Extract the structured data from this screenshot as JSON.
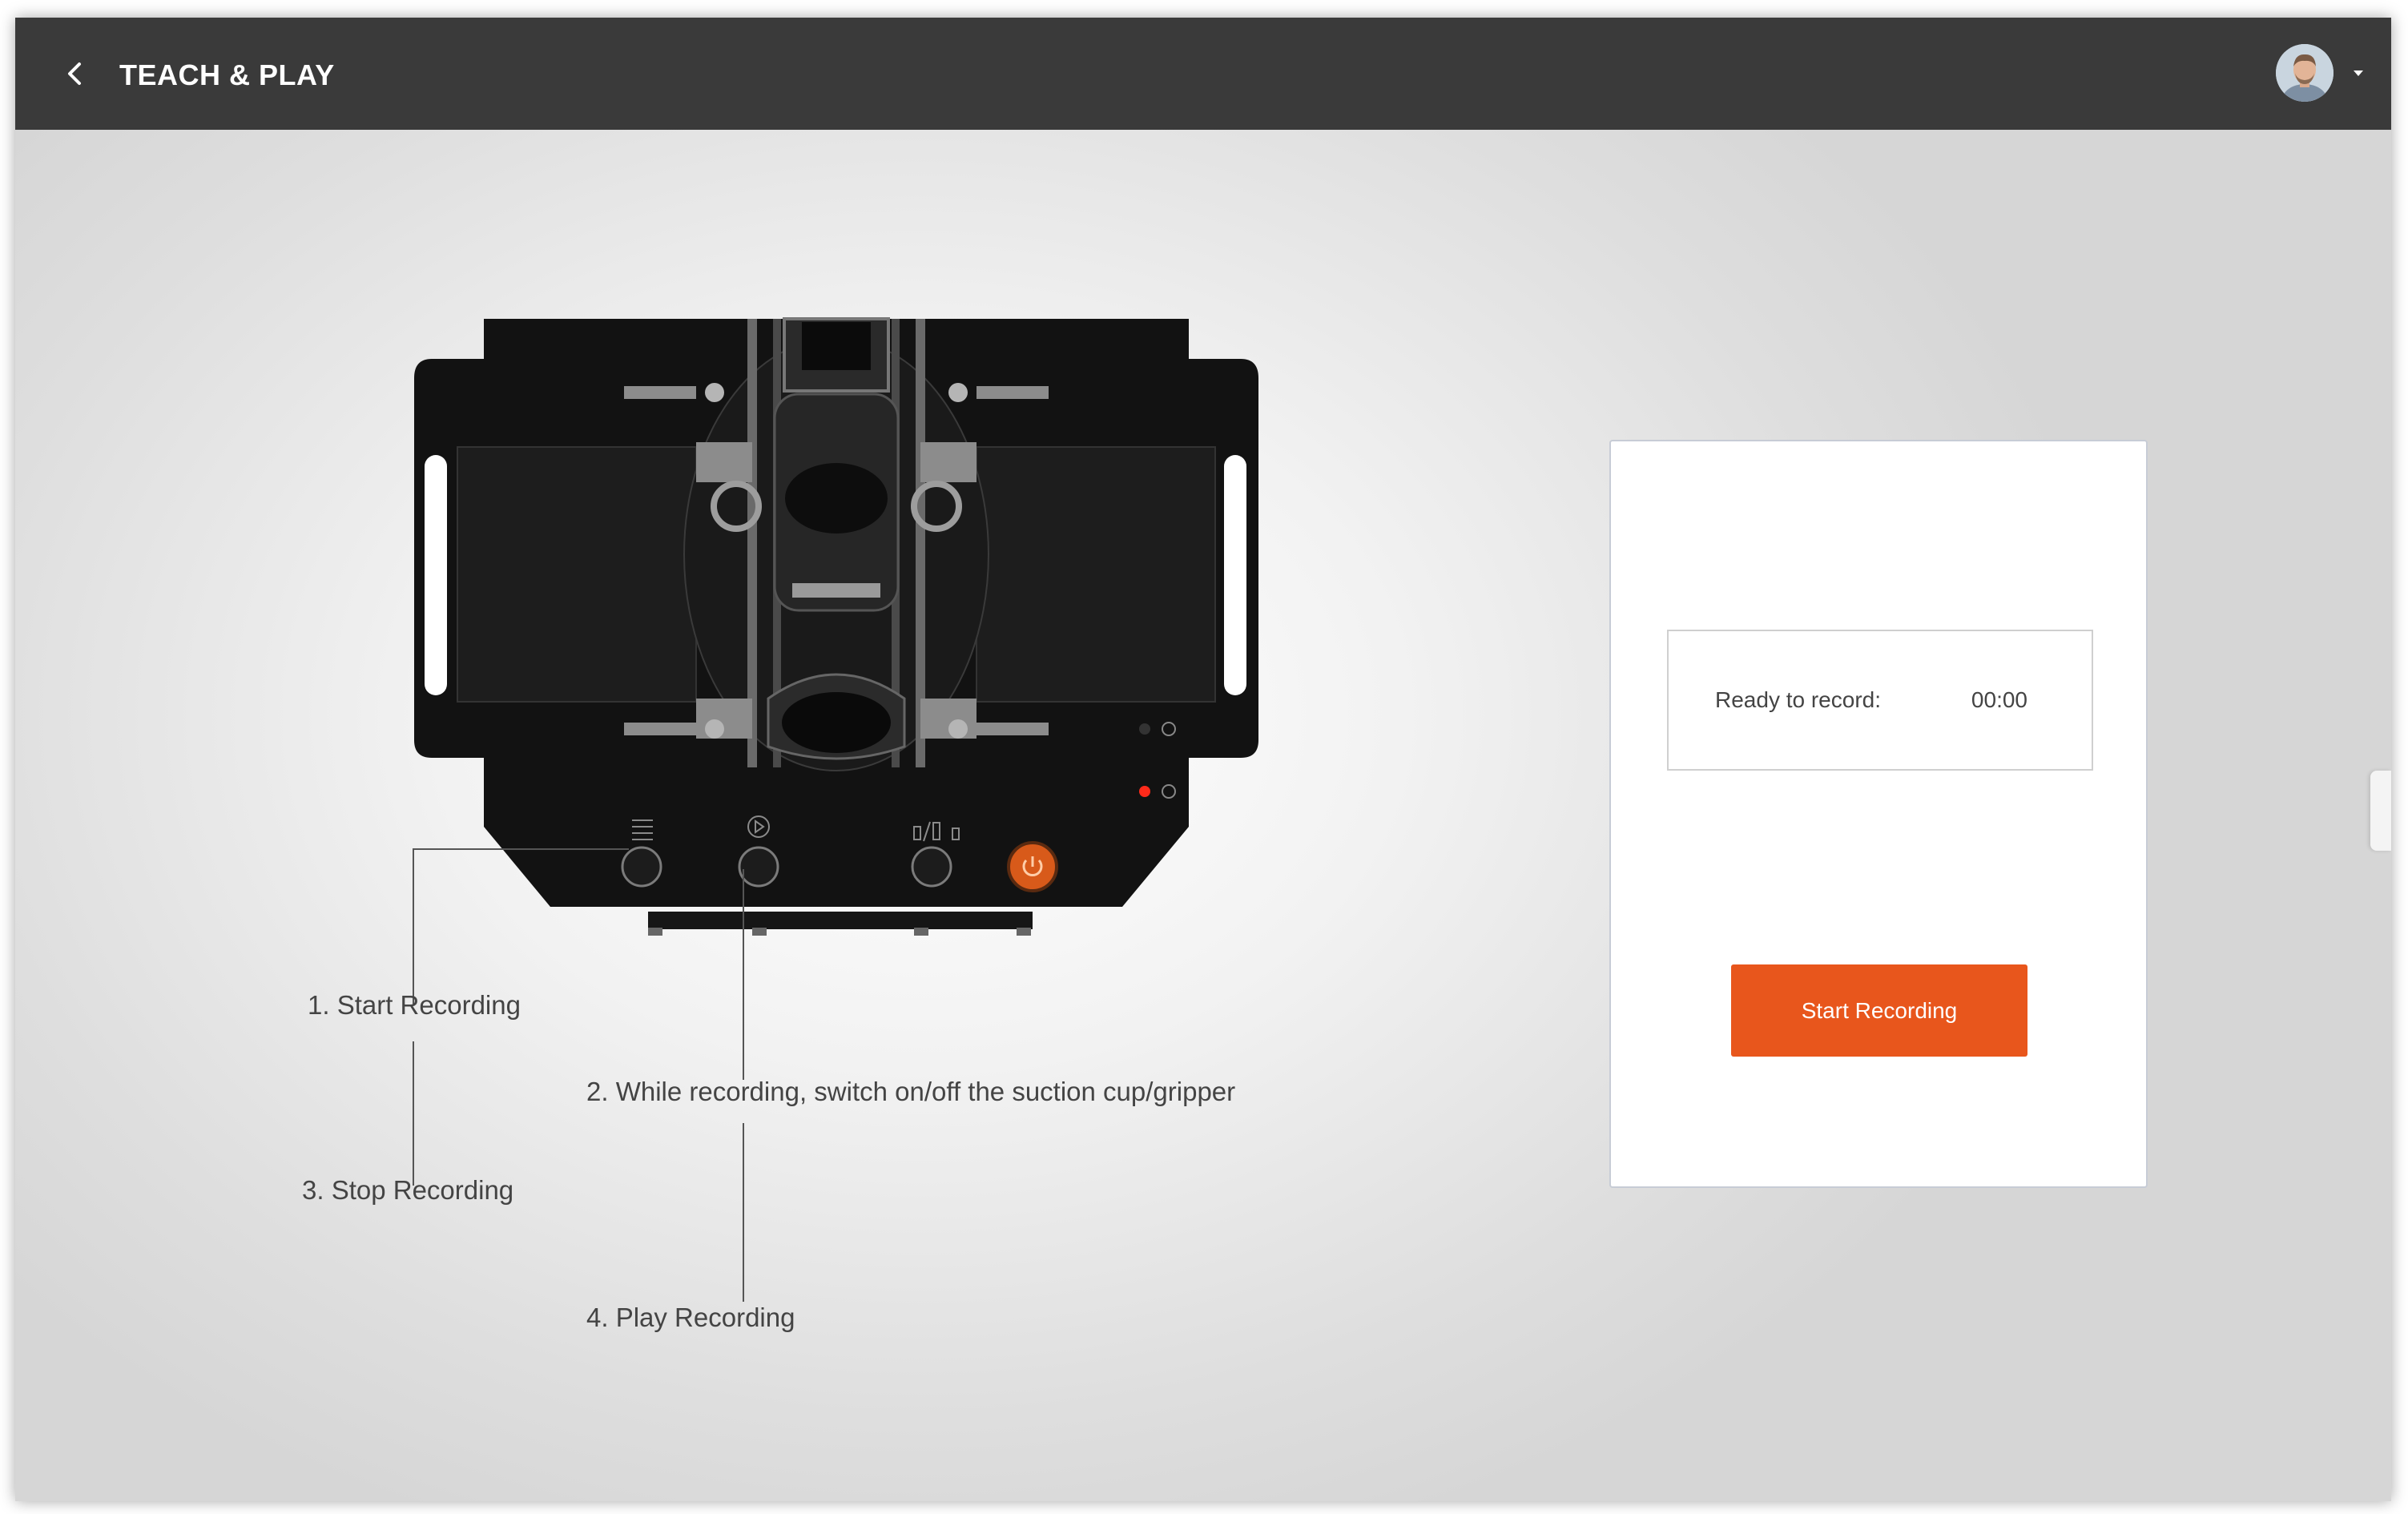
{
  "header": {
    "title": "TEACH & PLAY",
    "back_icon": "chevron-left-icon",
    "avatar_icon": "user-avatar",
    "dropdown_icon": "caret-down-icon"
  },
  "annotations": {
    "start": "1. Start Recording",
    "suction": "2. While recording, switch on/off the suction cup/gripper",
    "stop": "3. Stop Recording",
    "play": "4. Play Recording"
  },
  "recorder": {
    "status_label": "Ready to record:",
    "time": "00:00",
    "start_button": "Start Recording"
  },
  "colors": {
    "topbar": "#3a3a3a",
    "accent": "#e8561c",
    "robot_body": "#111111",
    "power_led": "#ff2a1a"
  }
}
